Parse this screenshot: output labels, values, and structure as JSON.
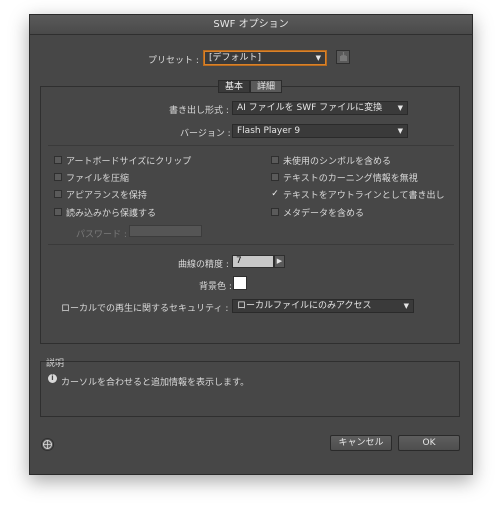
{
  "dialog": {
    "title": "SWF オプション"
  },
  "preset": {
    "label": "プリセット :",
    "value": "[デフォルト]"
  },
  "tabs": [
    {
      "label": "基本"
    },
    {
      "label": "詳細"
    }
  ],
  "export_as": {
    "label": "書き出し形式 :",
    "value": "AI ファイルを SWF ファイルに変換"
  },
  "version": {
    "label": "バージョン :",
    "value": "Flash Player 9"
  },
  "options_left": [
    {
      "label": "アートボードサイズにクリップ",
      "checked": false
    },
    {
      "label": "ファイルを圧縮",
      "checked": false
    },
    {
      "label": "アピアランスを保持",
      "checked": false
    },
    {
      "label": "読み込みから保護する",
      "checked": false
    }
  ],
  "options_right": [
    {
      "label": "未使用のシンボルを含める",
      "checked": false
    },
    {
      "label": "テキストのカーニング情報を無視",
      "checked": false
    },
    {
      "label": "テキストをアウトラインとして書き出し",
      "checked": true
    },
    {
      "label": "メタデータを含める",
      "checked": false
    }
  ],
  "password": {
    "label": "パスワード :",
    "value": ""
  },
  "curve_quality": {
    "label": "曲線の精度 :",
    "value": "7"
  },
  "background": {
    "label": "背景色 :",
    "color": "#ffffff"
  },
  "security": {
    "label": "ローカルでの再生に関するセキュリティ :",
    "value": "ローカルファイルにのみアクセス"
  },
  "description": {
    "title": "説明",
    "text": "カーソルを合わせると追加情報を表示します。"
  },
  "buttons": {
    "cancel": "キャンセル",
    "ok": "OK"
  },
  "colors": {
    "dialog_bg": "#474747",
    "accent": "#d9822b"
  }
}
